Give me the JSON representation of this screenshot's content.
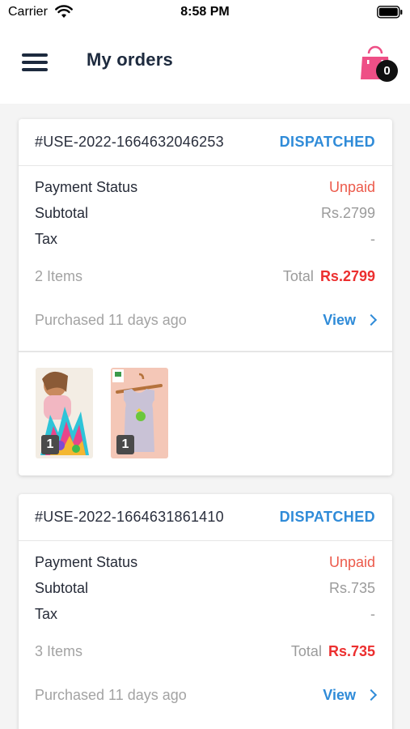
{
  "status_bar": {
    "carrier": "Carrier",
    "time": "8:58 PM"
  },
  "header": {
    "title": "My orders",
    "cart_count": "0"
  },
  "colors": {
    "status_blue": "#2f8bd8",
    "unpaid_red": "#ec5a4b",
    "total_red": "#ec2f2f",
    "cart_pink": "#ee4f86"
  },
  "orders": [
    {
      "id": "#USE-2022-1664632046253",
      "status": "DISPATCHED",
      "payment_status_label": "Payment Status",
      "payment_status": "Unpaid",
      "subtotal_label": "Subtotal",
      "subtotal": "Rs.2799",
      "tax_label": "Tax",
      "tax": "-",
      "items_count": "2 Items",
      "total_label": "Total",
      "total": "Rs.2799",
      "purchased": "Purchased 11 days ago",
      "view_label": "View",
      "products": [
        {
          "name": "building-blocks-toy",
          "qty": "1"
        },
        {
          "name": "kids-vest",
          "qty": "1"
        }
      ]
    },
    {
      "id": "#USE-2022-1664631861410",
      "status": "DISPATCHED",
      "payment_status_label": "Payment Status",
      "payment_status": "Unpaid",
      "subtotal_label": "Subtotal",
      "subtotal": "Rs.735",
      "tax_label": "Tax",
      "tax": "-",
      "items_count": "3 Items",
      "total_label": "Total",
      "total": "Rs.735",
      "purchased": "Purchased 11 days ago",
      "view_label": "View"
    }
  ]
}
